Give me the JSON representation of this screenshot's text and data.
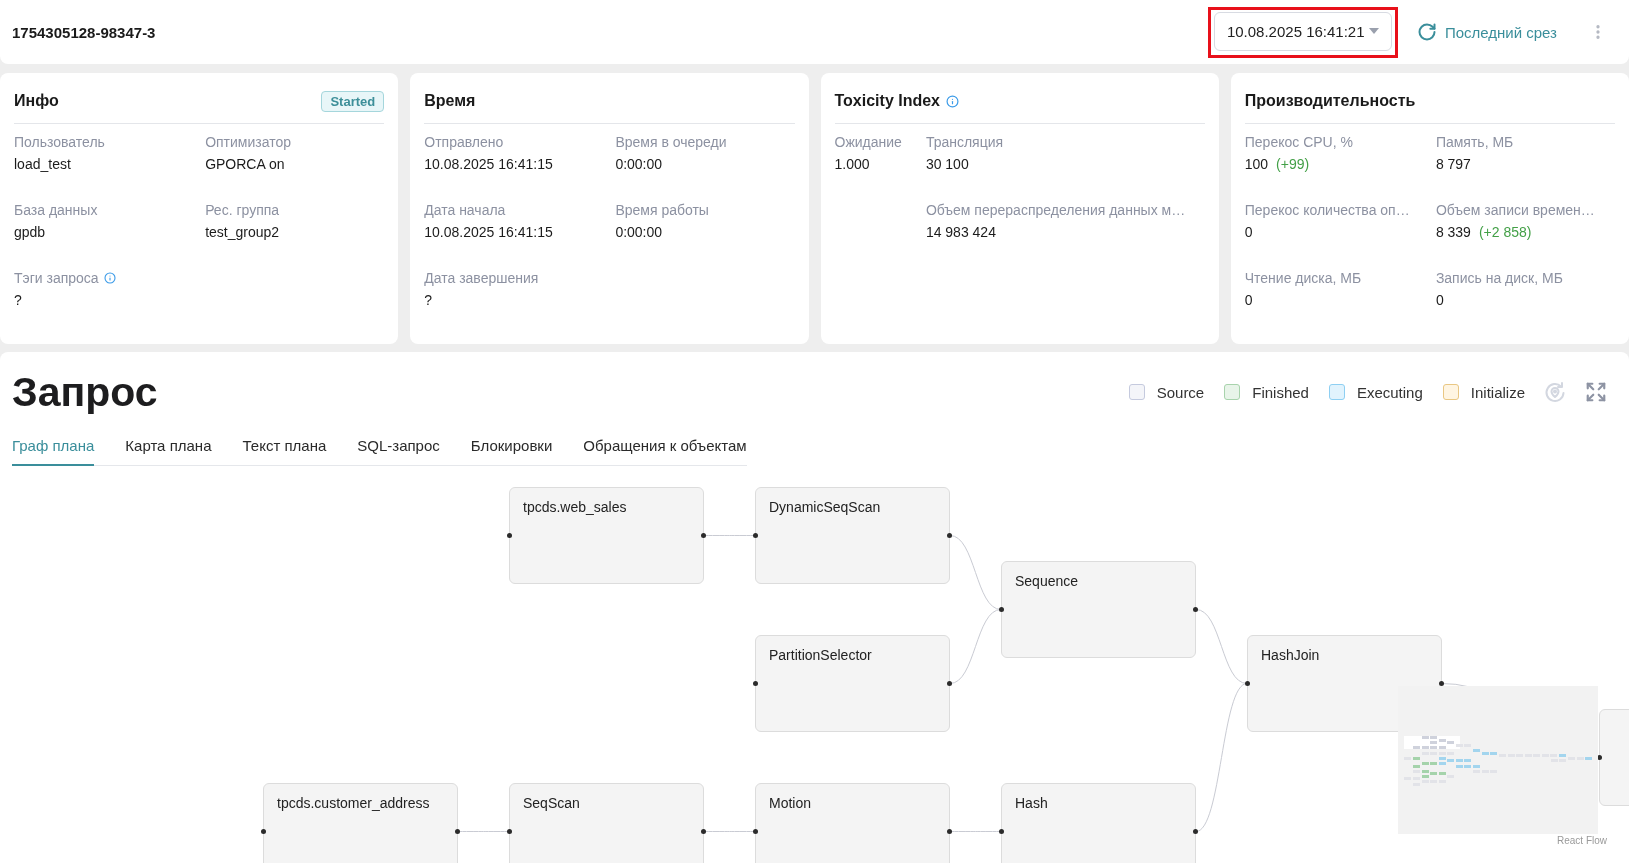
{
  "header": {
    "query_id": "1754305128-98347-3",
    "snapshot": {
      "value": "10.08.2025 16:41:21",
      "highlighted": true
    },
    "latest_button": "Последний срез"
  },
  "cards": [
    {
      "kind": "even",
      "title": "Инфо",
      "title_info": false,
      "badge": "Started",
      "columns": [
        [
          {
            "label": "Пользователь",
            "value": "load_test",
            "info": false
          },
          {
            "label": "База данных",
            "value": "gpdb",
            "info": false
          },
          {
            "label": "Тэги запроса",
            "value": "?",
            "info": true
          }
        ],
        [
          {
            "label": "Оптимизатор",
            "value": "GPORCA on",
            "info": false
          },
          {
            "label": "Рес. группа",
            "value": "test_group2",
            "info": false
          }
        ]
      ]
    },
    {
      "kind": "even",
      "title": "Время",
      "title_info": false,
      "columns": [
        [
          {
            "label": "Отправлено",
            "value": "10.08.2025 16:41:15",
            "info": false
          },
          {
            "label": "Дата начала",
            "value": "10.08.2025 16:41:15",
            "info": false
          },
          {
            "label": "Дата завершения",
            "value": "?",
            "info": false
          }
        ],
        [
          {
            "label": "Время в очереди",
            "value": "0:00:00",
            "info": false
          },
          {
            "label": "Время работы",
            "value": "0:00:00",
            "info": false
          }
        ]
      ]
    },
    {
      "kind": "compact",
      "title": "Toxicity Index",
      "title_info": true,
      "columns": [
        [
          {
            "label": "Ожидание",
            "value": "1.000",
            "info": false
          }
        ],
        [
          {
            "label": "Трансляция",
            "value": "30 100",
            "info": false
          },
          {
            "label": "Объем перераспределения данных м…",
            "value": "14 983 424",
            "info": false
          }
        ]
      ]
    },
    {
      "kind": "even",
      "title": "Производительность",
      "title_info": false,
      "columns": [
        [
          {
            "label": "Перекос CPU, %",
            "value": "100",
            "delta": "(+99)",
            "info": false
          },
          {
            "label": "Перекос количества оп…",
            "value": "0",
            "info": false
          },
          {
            "label": "Чтение диска, МБ",
            "value": "0",
            "info": false
          }
        ],
        [
          {
            "label": "Память, МБ",
            "value": "8 797",
            "info": false
          },
          {
            "label": "Объем записи времен…",
            "value": "8 339",
            "delta": "(+2 858)",
            "info": false
          },
          {
            "label": "Запись на диск, МБ",
            "value": "0",
            "info": false
          }
        ]
      ]
    }
  ],
  "query": {
    "title": "Запрос",
    "legend": [
      {
        "label": "Source",
        "color": "#f4f5f9"
      },
      {
        "label": "Finished",
        "color": "#e8f4e9"
      },
      {
        "label": "Executing",
        "color": "#e1f3fd"
      },
      {
        "label": "Initialize",
        "color": "#fff5e2"
      }
    ],
    "controls": [
      {
        "kind": "locate",
        "disabled": true
      },
      {
        "kind": "fullscreen",
        "disabled": false
      }
    ],
    "tabs": [
      {
        "label": "Граф плана",
        "selected": true
      },
      {
        "label": "Карта плана",
        "selected": false
      },
      {
        "label": "Текст плана",
        "selected": false
      },
      {
        "label": "SQL-запрос",
        "selected": false
      },
      {
        "label": "Блокировки",
        "selected": false
      },
      {
        "label": "Обращения к объектам",
        "selected": false
      }
    ],
    "plan": {
      "children": [
        {
          "label": "HashJoin",
          "children": [
            {
              "label": "Sequence",
              "children": [
                {
                  "label": "DynamicSeqScan",
                  "children": [
                    {
                      "label": "tpcds.web_sales"
                    }
                  ]
                },
                {
                  "label": "PartitionSelector"
                }
              ]
            },
            {
              "label": "Hash",
              "children": [
                {
                  "label": "Motion",
                  "children": [
                    {
                      "label": "SeqScan",
                      "children": [
                        {
                          "label": "tpcds.customer_address"
                        }
                      ]
                    }
                  ]
                }
              ]
            }
          ]
        }
      ]
    },
    "attribution": "React Flow"
  }
}
